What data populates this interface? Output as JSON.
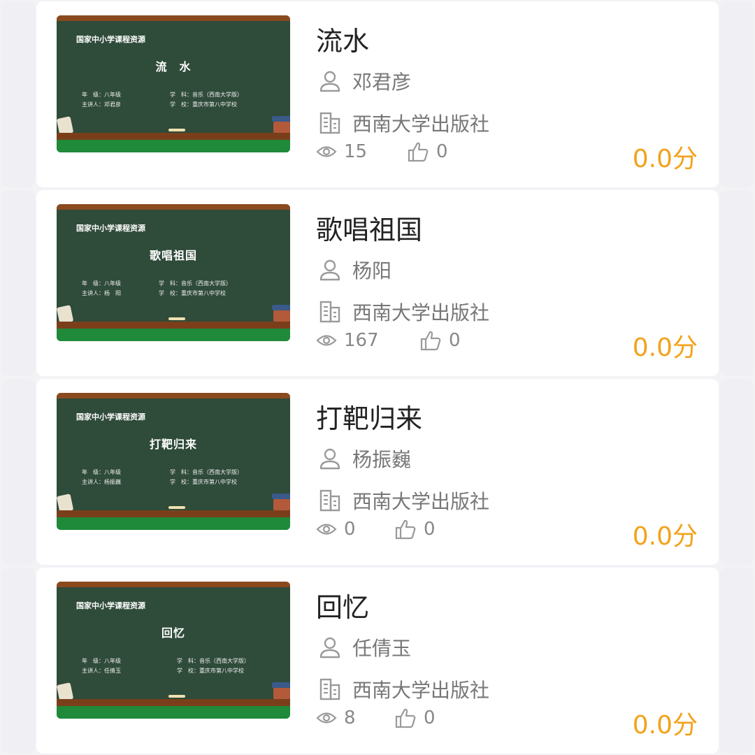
{
  "items": [
    {
      "title": "流水",
      "board_brand": "国家中小学课程资源",
      "board_title": "流　水",
      "board_grade": "年　级：八年级",
      "board_subject": "学　科：音乐（西南大学版）",
      "board_teacher": "主讲人：邓君彦",
      "board_school": "学　校：重庆市第八中学校",
      "author": "邓君彦",
      "publisher": "西南大学出版社",
      "views": "15",
      "likes": "0",
      "score": "0.0分"
    },
    {
      "title": "歌唱祖国",
      "board_brand": "国家中小学课程资源",
      "board_title": "歌唱祖国",
      "board_grade": "年　级：八年级",
      "board_subject": "学　科：音乐（西南大学版）",
      "board_teacher": "主讲人：杨　阳",
      "board_school": "学　校：重庆市第八中学校",
      "author": "杨阳",
      "publisher": "西南大学出版社",
      "views": "167",
      "likes": "0",
      "score": "0.0分"
    },
    {
      "title": "打靶归来",
      "board_brand": "国家中小学课程资源",
      "board_title": "打靶归来",
      "board_grade": "年　级：八年级",
      "board_subject": "学　科：音乐（西南大学版）",
      "board_teacher": "主讲人：杨振巍",
      "board_school": "学　校：重庆市第八中学校",
      "author": "杨振巍",
      "publisher": "西南大学出版社",
      "views": "0",
      "likes": "0",
      "score": "0.0分"
    },
    {
      "title": "回忆",
      "board_brand": "国家中小学课程资源",
      "board_title": "回忆",
      "board_grade": "年　级：八年级",
      "board_subject": "学　科：音乐（西南大学版）",
      "board_teacher": "主讲人：任倩玉",
      "board_school": "学　校：重庆市第八中学校",
      "author": "任倩玉",
      "publisher": "西南大学出版社",
      "views": "8",
      "likes": "0",
      "score": "0.0分"
    }
  ],
  "colors": {
    "score": "#f3a21b",
    "board": "#2f4b3a",
    "grass": "#1f8a3a"
  },
  "icons": {
    "author": "person-icon",
    "publisher": "building-icon",
    "views": "eye-icon",
    "likes": "thumbs-up-icon"
  }
}
